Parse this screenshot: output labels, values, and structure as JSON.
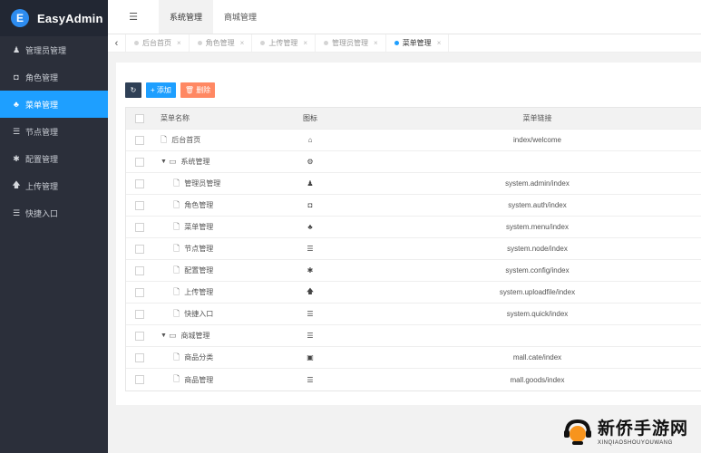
{
  "app": {
    "title": "EasyAdmin",
    "logo_letter": "E"
  },
  "sidebar": {
    "items": [
      {
        "label": "管理员管理",
        "icon": "user-icon",
        "glyph": "♟",
        "active": false
      },
      {
        "label": "角色管理",
        "icon": "save-icon",
        "glyph": "◘",
        "active": false
      },
      {
        "label": "菜单管理",
        "icon": "bell-icon",
        "glyph": "♣",
        "active": true
      },
      {
        "label": "节点管理",
        "icon": "list-icon",
        "glyph": "☰",
        "active": false
      },
      {
        "label": "配置管理",
        "icon": "asterisk-icon",
        "glyph": "✱",
        "active": false
      },
      {
        "label": "上传管理",
        "icon": "arrow-up-icon",
        "glyph": "🡅",
        "active": false
      },
      {
        "label": "快捷入口",
        "icon": "list-icon",
        "glyph": "☰",
        "active": false
      }
    ]
  },
  "header": {
    "toggle_glyph": "☰",
    "tabs": [
      {
        "label": "系统管理",
        "active": true
      },
      {
        "label": "商城管理",
        "active": false
      }
    ]
  },
  "tabbar": {
    "prev_glyph": "‹",
    "close_glyph": "×",
    "tabs": [
      {
        "label": "后台首页",
        "active": false
      },
      {
        "label": "角色管理",
        "active": false
      },
      {
        "label": "上传管理",
        "active": false
      },
      {
        "label": "管理员管理",
        "active": false
      },
      {
        "label": "菜单管理",
        "active": true
      }
    ]
  },
  "toolbar": {
    "refresh_glyph": "↻",
    "add_label": "+ 添加",
    "delete_label": "🗑 删除"
  },
  "table": {
    "headers": {
      "name": "菜单名称",
      "icon": "图标",
      "link": "菜单链接"
    },
    "rows": [
      {
        "name": "后台首页",
        "level": 0,
        "type": "file",
        "icon": "home-icon",
        "glyph": "⌂",
        "link": "index/welcome"
      },
      {
        "name": "系统管理",
        "level": 0,
        "type": "folder",
        "icon": "gear-icon",
        "glyph": "⚙",
        "link": ""
      },
      {
        "name": "管理员管理",
        "level": 1,
        "type": "file",
        "icon": "user-icon",
        "glyph": "♟",
        "link": "system.admin/index"
      },
      {
        "name": "角色管理",
        "level": 1,
        "type": "file",
        "icon": "save-icon",
        "glyph": "◘",
        "link": "system.auth/index"
      },
      {
        "name": "菜单管理",
        "level": 1,
        "type": "file",
        "icon": "bell-icon",
        "glyph": "♣",
        "link": "system.menu/index"
      },
      {
        "name": "节点管理",
        "level": 1,
        "type": "file",
        "icon": "list-icon",
        "glyph": "☰",
        "link": "system.node/index"
      },
      {
        "name": "配置管理",
        "level": 1,
        "type": "file",
        "icon": "asterisk-icon",
        "glyph": "✱",
        "link": "system.config/index"
      },
      {
        "name": "上传管理",
        "level": 1,
        "type": "file",
        "icon": "arrow-up-icon",
        "glyph": "🡅",
        "link": "system.uploadfile/index"
      },
      {
        "name": "快捷入口",
        "level": 1,
        "type": "file",
        "icon": "list-icon",
        "glyph": "☰",
        "link": "system.quick/index"
      },
      {
        "name": "商城管理",
        "level": 0,
        "type": "folder",
        "icon": "list-icon",
        "glyph": "☰",
        "link": ""
      },
      {
        "name": "商品分类",
        "level": 1,
        "type": "file",
        "icon": "calendar-check-icon",
        "glyph": "▣",
        "link": "mall.cate/index"
      },
      {
        "name": "商品管理",
        "level": 1,
        "type": "file",
        "icon": "list-icon",
        "glyph": "☰",
        "link": "mall.goods/index"
      }
    ]
  },
  "watermark": {
    "cn": "新侨手游网",
    "en": "XINQIAOSHOUYOUWANG"
  },
  "colors": {
    "sidebar_bg": "#2b2f3a",
    "accent": "#1e9fff",
    "danger": "#ff5722",
    "refresh": "#2f4056"
  }
}
